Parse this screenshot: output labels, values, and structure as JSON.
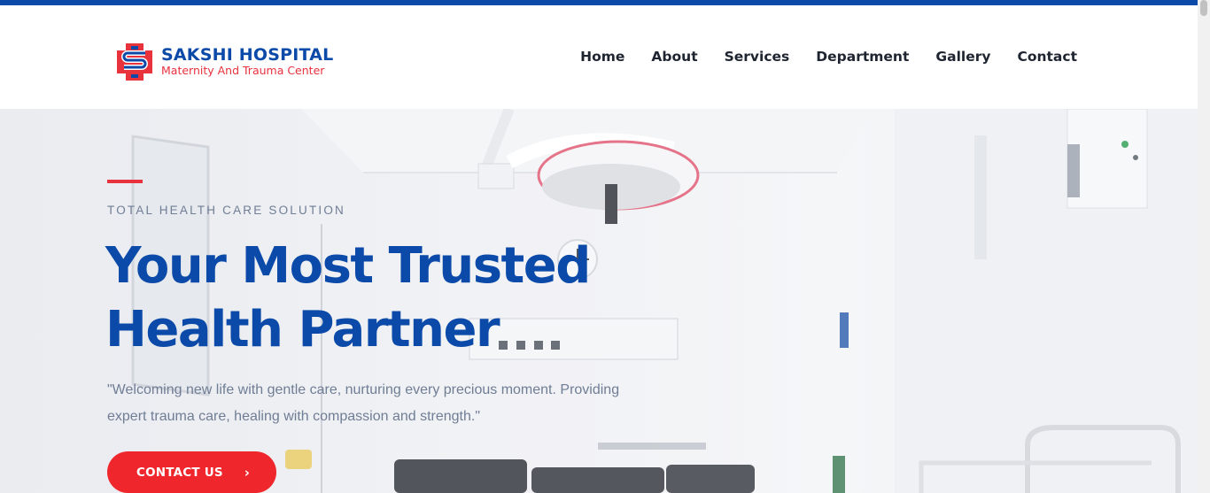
{
  "brand": {
    "name": "SAKSHI HOSPITAL",
    "tagline": "Maternity And Trauma Center",
    "primary_color": "#0b4aa8",
    "accent_color": "#e8323c"
  },
  "nav": {
    "items": [
      {
        "label": "Home"
      },
      {
        "label": "About"
      },
      {
        "label": "Services"
      },
      {
        "label": "Department"
      },
      {
        "label": "Gallery"
      },
      {
        "label": "Contact"
      }
    ]
  },
  "hero": {
    "eyebrow": "TOTAL HEALTH CARE SOLUTION",
    "headline_line1": "Your Most Trusted",
    "headline_line2": "Health Partner",
    "lede": "\"Welcoming new life with gentle care, nurturing every precious moment. Providing expert trauma care, healing with compassion and strength.\"",
    "cta_label": "CONTACT US",
    "cta_icon": "chevron-right-icon"
  }
}
